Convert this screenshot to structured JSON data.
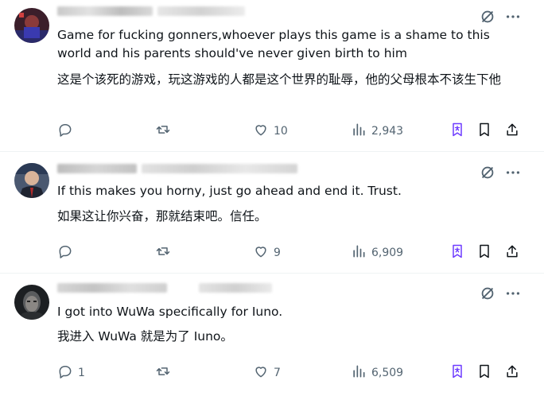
{
  "replies": [
    {
      "text_en": "Game for fucking gonners,whoever plays this game is a shame to this world and his parents should've never given birth to him",
      "text_zh": "这是个该死的游戏，玩这游戏的人都是这个世界的耻辱，他的父母根本不该生下他",
      "comments": "",
      "likes": "10",
      "views": "2,943"
    },
    {
      "text_en": "If this makes you horny, just go ahead and end it. Trust.",
      "text_zh": "如果这让你兴奋，那就结束吧。信任。",
      "comments": "",
      "likes": "9",
      "views": "6,909"
    },
    {
      "text_en": "I got into WuWa specifically for Iuno.",
      "text_zh": "我进入 WuWa 就是为了 Iuno。",
      "comments": "1",
      "likes": "7",
      "views": "6,509"
    }
  ],
  "icons": {
    "more": "more-horizontal-icon",
    "grok": "grok-icon",
    "reply": "reply-icon",
    "retweet": "retweet-icon",
    "like": "heart-icon",
    "views": "views-chart-icon",
    "translate": "translate-icon",
    "bookmark": "bookmark-icon",
    "share": "share-icon"
  },
  "colors": {
    "text": "#0f1419",
    "secondary": "#536471",
    "accent": "#6e3cff",
    "divider": "#eff3f4"
  }
}
